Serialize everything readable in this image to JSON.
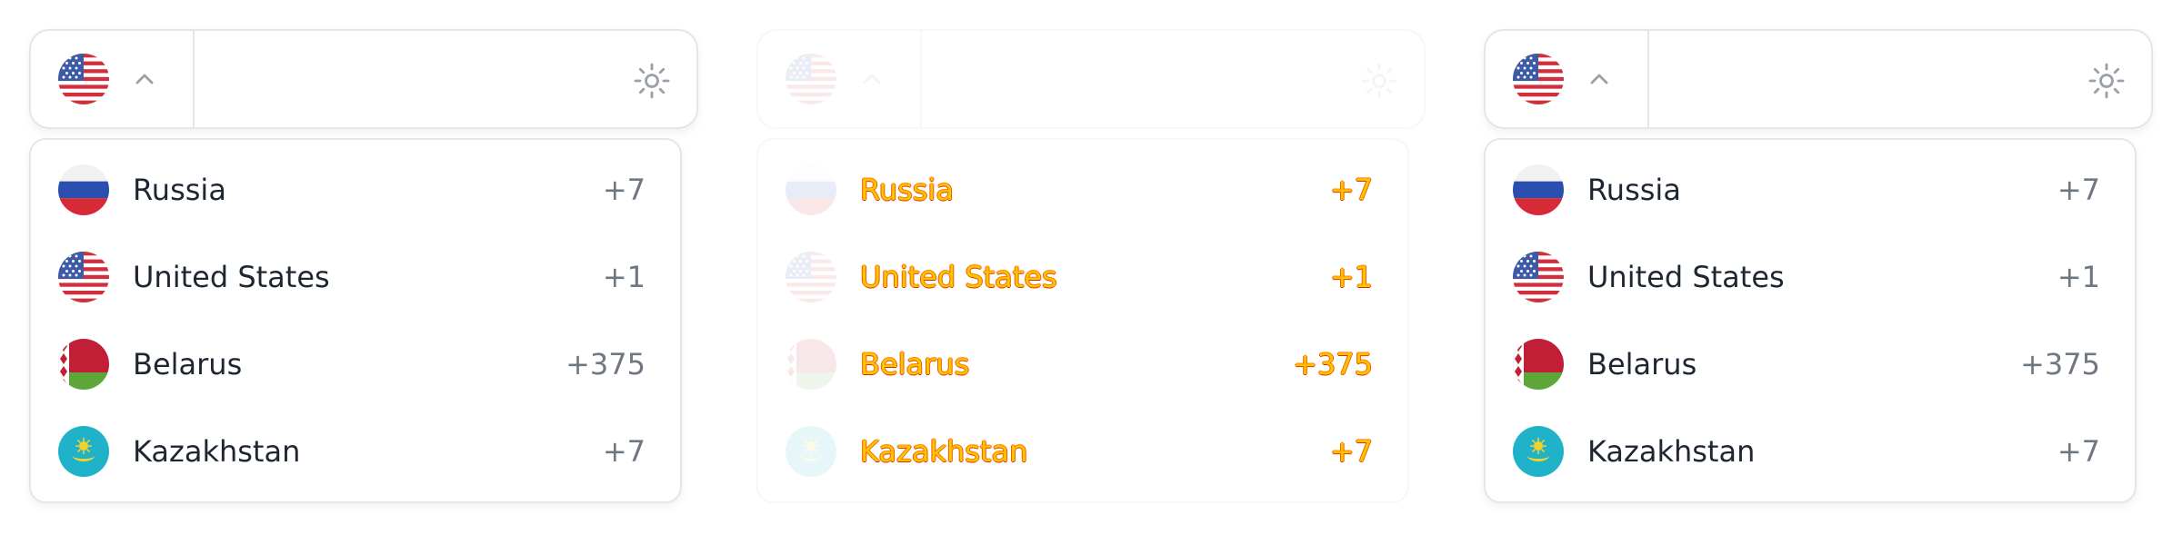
{
  "selected_country": {
    "flag": "us-flag-icon"
  },
  "phone_input": {
    "value": "",
    "placeholder": ""
  },
  "icons": {
    "chevron": "chevron-up-icon",
    "theme": "sun-icon"
  },
  "countries": [
    {
      "name": "Russia",
      "code": "+7",
      "flag": "ru-flag-icon"
    },
    {
      "name": "United States",
      "code": "+1",
      "flag": "us-flag-icon"
    },
    {
      "name": "Belarus",
      "code": "+375",
      "flag": "by-flag-icon"
    },
    {
      "name": "Kazakhstan",
      "code": "+7",
      "flag": "kz-flag-icon"
    }
  ],
  "colors": {
    "border": "#e4e6ea",
    "text": "#1f2633",
    "code_text": "#6f7684",
    "icon_gray": "#9aa0a8",
    "ghost_text_fill": "#ffc400",
    "ghost_text_edge": "#f25a00"
  }
}
